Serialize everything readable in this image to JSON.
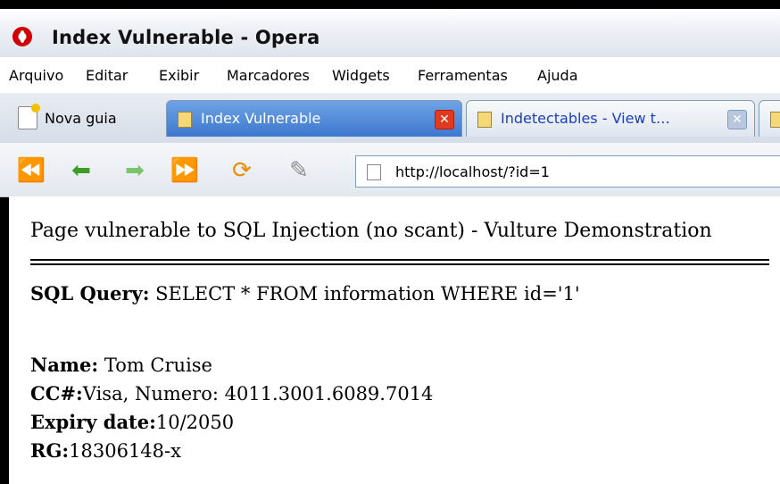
{
  "window": {
    "title": "Index Vulnerable - Opera"
  },
  "menu": [
    "Arquivo",
    "Editar",
    "Exibir",
    "Marcadores",
    "Widgets",
    "Ferramentas",
    "Ajuda"
  ],
  "tabs": {
    "new_tab_label": "Nova guia",
    "active_label": "Index Vulnerable",
    "inactive_label": "Indetectables - View t…"
  },
  "nav": {
    "url": "http://localhost/?id=1"
  },
  "page": {
    "heading": "Page vulnerable to SQL Injection (no scant) - Vulture Demonstration",
    "query_label": "SQL Query:",
    "query_value": "SELECT * FROM information WHERE id='1'",
    "name_label": "Name:",
    "name_value": "Tom Cruise",
    "cc_label": "CC#:",
    "cc_value": "Visa, Numero: 4011.3001.6089.7014",
    "expiry_label": "Expiry date:",
    "expiry_value": "10/2050",
    "rg_label": "RG:",
    "rg_value": "18306148-x"
  },
  "colors": {
    "active_tab": "#3e78cf",
    "close_red": "#e23a1f",
    "inactive_link": "#1a3fbf"
  }
}
